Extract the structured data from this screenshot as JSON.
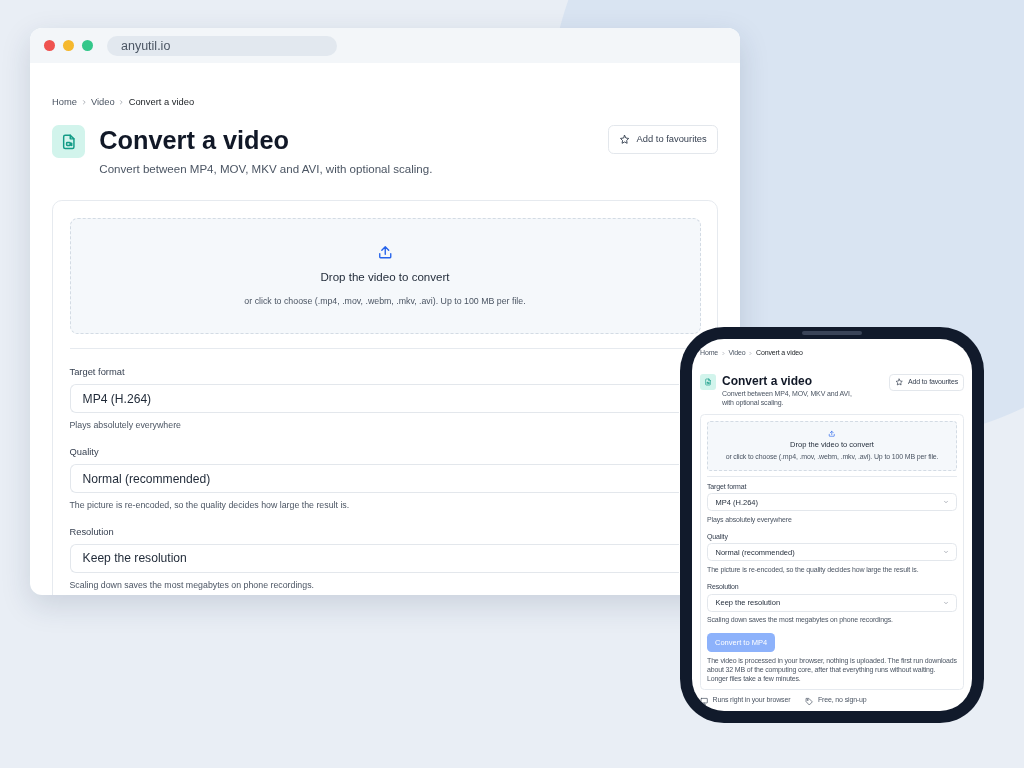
{
  "browser": {
    "url": "anyutil.io",
    "page": {
      "breadcrumb": [
        "Home",
        "Video",
        "Convert a video"
      ],
      "title": "Convert a video",
      "subtitle": "Convert between MP4, MOV, MKV and AVI, with optional scaling.",
      "favourite": "Add to favourites",
      "dropzone": {
        "title": "Drop the video to convert",
        "hint": "or click to choose (.mp4, .mov, .webm, .mkv, .avi). Up to 100 MB per file."
      },
      "fields": [
        {
          "label": "Target format",
          "value": "MP4 (H.264)",
          "hint": "Plays absolutely everywhere"
        },
        {
          "label": "Quality",
          "value": "Normal (recommended)",
          "hint": "The picture is re-encoded, so the quality decides how large the result is."
        },
        {
          "label": "Resolution",
          "value": "Keep the resolution",
          "hint": "Scaling down saves the most megabytes on phone recordings."
        }
      ]
    }
  },
  "phone": {
    "page": {
      "breadcrumb": [
        "Home",
        "Video",
        "Convert a video"
      ],
      "title": "Convert a video",
      "subtitle": "Convert between MP4, MOV, MKV and AVI, with optional scaling.",
      "favourite": "Add to favourites",
      "dropzone": {
        "title": "Drop the video to convert",
        "hint": "or click to choose (.mp4, .mov, .webm, .mkv, .avi). Up to 100 MB per file."
      },
      "fields": [
        {
          "label": "Target format",
          "value": "MP4 (H.264)",
          "hint": "Plays absolutely everywhere"
        },
        {
          "label": "Quality",
          "value": "Normal (recommended)",
          "hint": "The picture is re-encoded, so the quality decides how large the result is."
        },
        {
          "label": "Resolution",
          "value": "Keep the resolution",
          "hint": "Scaling down saves the most megabytes on phone recordings."
        }
      ],
      "convert": {
        "label": "Convert to MP4",
        "disabled": true
      },
      "note": "The video is processed in your browser, nothing is uploaded. The first run downloads about 32 MB of the computing core, after that everything runs without waiting. Longer files take a few minutes.",
      "features": [
        {
          "kind": "monitor",
          "label": "Runs right in your browser"
        },
        {
          "kind": "tag",
          "label": "Free, no sign-up"
        }
      ]
    }
  }
}
